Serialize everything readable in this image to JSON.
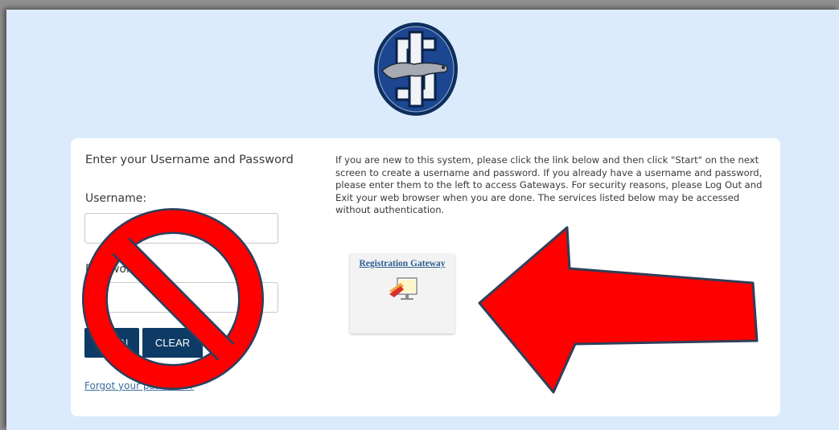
{
  "login": {
    "title": "Enter your Username and Password",
    "username_label": "Username:",
    "password_label": "Password:",
    "username_value": "",
    "password_value": "",
    "login_button": "LOGIN",
    "clear_button": "CLEAR",
    "forgot_link": "Forgot your password?"
  },
  "info": {
    "text": "If you are new to this system, please click the link below and then click \"Start\" on the next screen to create a username and password. If you already have a username and password, please enter them to the left to access Gateways. For security reasons, please Log Out and Exit your web browser when you are done.  The services listed below may be accessed without authentication."
  },
  "gateway": {
    "label": "Registration Gateway",
    "icon": "registration-icon"
  },
  "logo": {
    "icon": "school-logo-greyhound"
  },
  "annotations": {
    "prohibit_icon": "no-symbol",
    "arrow_icon": "red-arrow-left",
    "color": "#ff0000"
  },
  "colors": {
    "background": "#dbebfb",
    "button": "#0e3a66",
    "link": "#2b5e93"
  }
}
